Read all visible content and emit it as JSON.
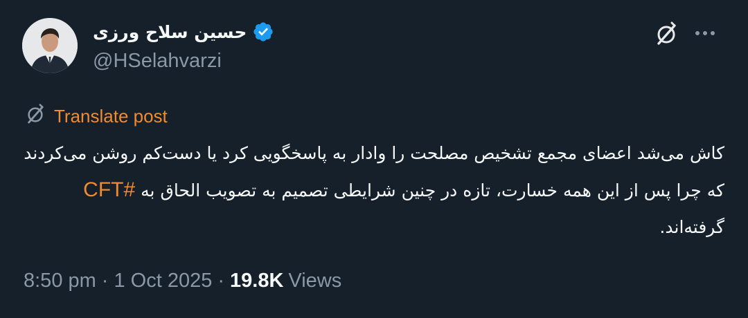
{
  "author": {
    "display_name": "حسین سلاح ورزی",
    "handle": "@HSelahvarzi",
    "verified": true,
    "verified_color": "#1d9bf0"
  },
  "header_icons": {
    "grok": "grok-icon",
    "more": "more-icon"
  },
  "translate": {
    "label": "Translate post",
    "icon": "globe-icon",
    "color": "#f28a2e"
  },
  "post": {
    "text_before": "کاش می‌شد اعضای مجمع تشخیص مصلحت را وادار به پاسخگویی کرد یا دست‌کم روشن می‌کردند که چرا پس از این همه خسارت، تازه در چنین شرایطی تصمیم به تصویب الحاق به",
    "hashtag": "#CFT",
    "text_after": "گرفته‌اند."
  },
  "meta": {
    "time": "8:50 pm",
    "separator": "·",
    "date": "1 Oct 2025",
    "views_count": "19.8K",
    "views_label": "Views"
  },
  "colors": {
    "background": "#15202b",
    "primary_text": "#f7f9f9",
    "secondary_text": "#8b98a5",
    "accent": "#f28a2e"
  }
}
